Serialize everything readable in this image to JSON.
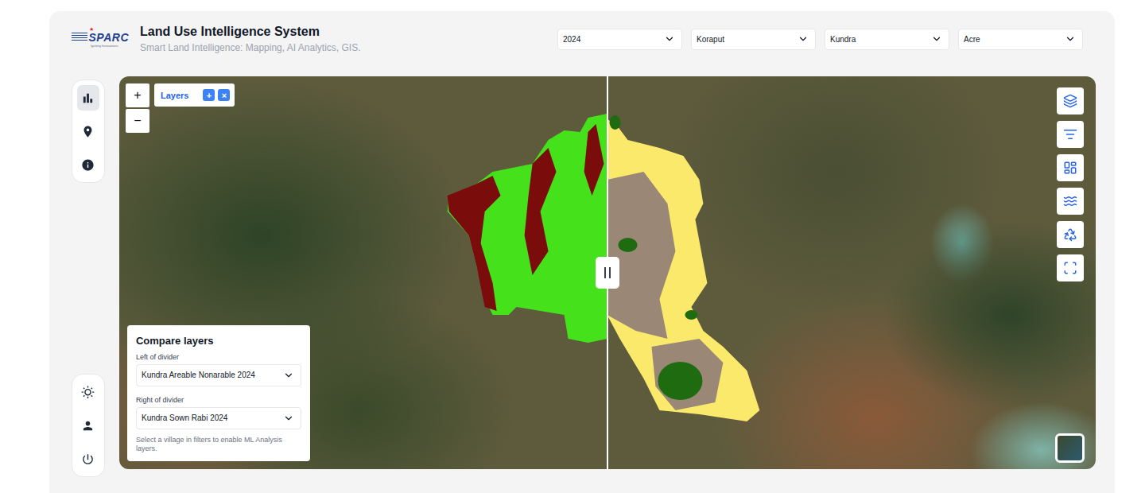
{
  "header": {
    "logo": {
      "text": "SPARC",
      "tagline": "Igniting Innovations",
      "star": "★"
    },
    "title": "Land Use Intelligence System",
    "subtitle": "Smart Land Intelligence: Mapping, AI Analytics, GIS.",
    "filters": [
      {
        "value": "2024"
      },
      {
        "value": "Koraput"
      },
      {
        "value": "Kundra"
      },
      {
        "value": "Acre"
      }
    ]
  },
  "sidebar": {
    "top": [
      {
        "selected": true
      },
      {
        "selected": false
      },
      {
        "selected": false
      }
    ],
    "bottom": [
      {
        "selected": false
      },
      {
        "selected": false
      },
      {
        "selected": false
      }
    ]
  },
  "map": {
    "zoom": [
      "+",
      "−"
    ],
    "layers": {
      "label": "Layers",
      "buttons": [
        "+",
        "×"
      ]
    },
    "overlay_classes": {
      "left": [
        "#45e21c",
        "#7b0c0c"
      ],
      "right": [
        "#fbe96b",
        "#9a8776",
        "#1e6b10"
      ]
    },
    "compare": {
      "title": "Compare layers",
      "left": {
        "label": "Left of divider",
        "value": "Kundra Areable Nonarable 2024"
      },
      "right": {
        "label": "Right of divider",
        "value": "Kundra Sown Rabi 2024"
      },
      "hint": "Select a village in filters to enable ML Analysis layers."
    }
  }
}
